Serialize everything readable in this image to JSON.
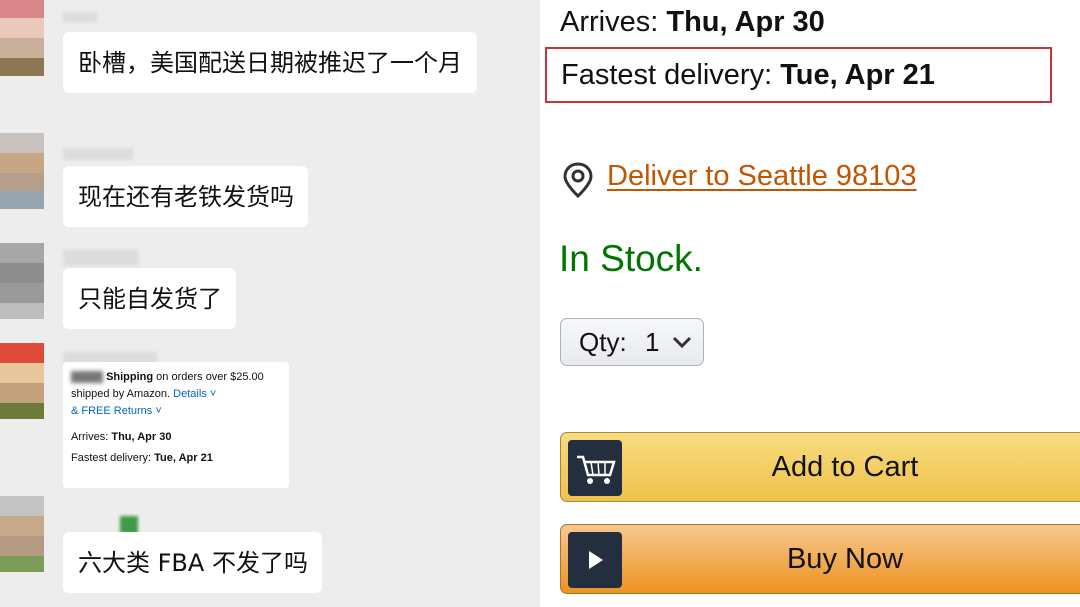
{
  "chat": {
    "messages": [
      {
        "text": "卧槽，美国配送日期被推迟了一个月"
      },
      {
        "text": "现在还有老铁发货吗"
      },
      {
        "text": "只能自发货了"
      },
      {
        "text": "六大类 FBA 不发了吗"
      }
    ],
    "shared_card": {
      "shipping_word": "Shipping",
      "shipping_suffix": " on orders over $25.00",
      "shipped_by": "shipped by Amazon.",
      "details": "Details",
      "free_returns": "& FREE Returns",
      "arrives_label": "Arrives:",
      "arrives_value": "Thu, Apr 30",
      "fastest_label": "Fastest delivery:",
      "fastest_value": "Tue, Apr 21"
    }
  },
  "product": {
    "arrives_label": "Arrives:",
    "arrives_value": "Thu, Apr 30",
    "fastest_label": "Fastest delivery:",
    "fastest_value": "Tue, Apr 21",
    "deliver_to": "Deliver to Seattle 98103",
    "stock_status": "In Stock.",
    "qty_label": "Qty:",
    "qty_value": "1",
    "add_to_cart": "Add to Cart",
    "buy_now": "Buy Now"
  },
  "colors": {
    "highlight_border": "#c8323a",
    "link": "#c45500",
    "in_stock": "#007600",
    "cart_button": "#f0c14b",
    "buy_button": "#ed9220"
  },
  "icons": [
    "location-pin-icon",
    "chevron-down-icon",
    "shopping-cart-icon",
    "play-icon"
  ]
}
